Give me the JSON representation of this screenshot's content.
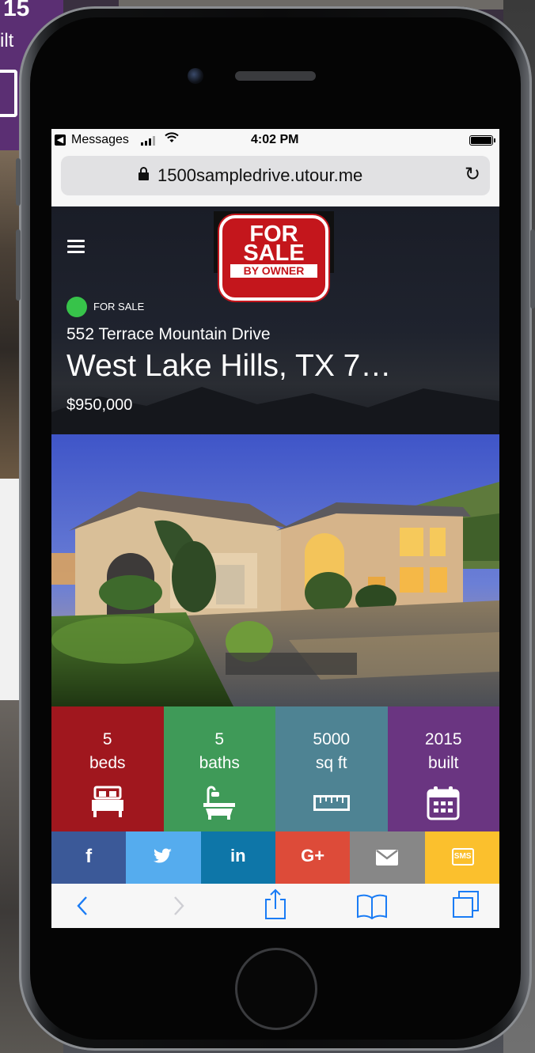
{
  "background": {
    "card_value": "15",
    "card_label": "ilt"
  },
  "status_bar": {
    "app_name": "Messages",
    "time": "4:02 PM"
  },
  "browser": {
    "url": "1500sampledrive.utour.me"
  },
  "logo": {
    "line1": "FOR",
    "line2": "SALE",
    "line3": "BY OWNER"
  },
  "listing": {
    "status": "FOR SALE",
    "street": "552 Terrace Mountain Drive",
    "city": "West Lake Hills, TX 7…",
    "price": "$950,000"
  },
  "stats": [
    {
      "value": "5",
      "label": "beds",
      "icon": "bed-icon",
      "color": "#a0171e"
    },
    {
      "value": "5",
      "label": "baths",
      "icon": "bathtub-icon",
      "color": "#3f9a58"
    },
    {
      "value": "5000",
      "label": "sq ft",
      "icon": "ruler-icon",
      "color": "#4e8393"
    },
    {
      "value": "2015",
      "label": "built",
      "icon": "calendar-icon",
      "color": "#6a3581"
    }
  ],
  "share": [
    {
      "label": "f",
      "name": "facebook",
      "color": "#3b5998"
    },
    {
      "label": "",
      "name": "twitter",
      "color": "#55acee"
    },
    {
      "label": "in",
      "name": "linkedin",
      "color": "#0e76a8"
    },
    {
      "label": "G+",
      "name": "google-plus",
      "color": "#dd4b39"
    },
    {
      "label": "",
      "name": "email",
      "color": "#878787"
    },
    {
      "label": "SMS",
      "name": "sms",
      "color": "#fbc02d"
    }
  ],
  "colors": {
    "status_dot": "#37c34a",
    "ios_blue": "#1a7cf5"
  }
}
